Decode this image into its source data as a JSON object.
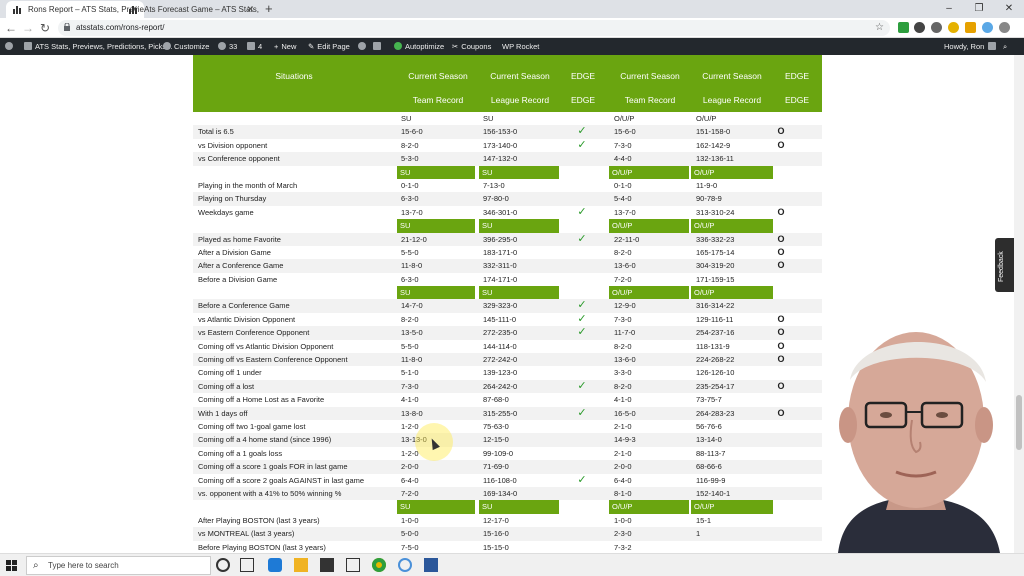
{
  "browser": {
    "tabs": [
      {
        "label": "Rons Report – ATS Stats, Previe",
        "active": true
      },
      {
        "label": "Ats Forecast Game – ATS Stats, F",
        "active": false
      }
    ],
    "url": "atsstats.com/rons-report/"
  },
  "wpbar": {
    "site": "ATS Stats, Previews, Predictions, Picks...",
    "customize": "Customize",
    "updates": "33",
    "comments": "4",
    "new": "New",
    "edit": "Edit Page",
    "autoptimize": "Autoptimize",
    "coupons": "Coupons",
    "wprocket": "WP Rocket",
    "howdy": "Howdy, Ron"
  },
  "table": {
    "headers": {
      "situations": "Situations",
      "current_season": "Current Season",
      "edge": "EDGE",
      "team_record": "Team Record",
      "league_record": "League Record"
    },
    "rows": [
      {
        "type": "data",
        "sit": "",
        "tr": "SU",
        "lr": "SU",
        "e1": "",
        "tr2": "O/U/P",
        "lr2": "O/U/P",
        "e2": ""
      },
      {
        "type": "data",
        "sit": "Total is 6.5",
        "tr": "15-6-0",
        "lr": "156-153-0",
        "e1": "✓",
        "tr2": "15-6-0",
        "lr2": "151-158-0",
        "e2": "O"
      },
      {
        "type": "data",
        "sit": "vs Division opponent",
        "tr": "8-2-0",
        "lr": "173-140-0",
        "e1": "✓",
        "tr2": "7-3-0",
        "lr2": "162-142-9",
        "e2": "O"
      },
      {
        "type": "data",
        "sit": "vs Conference opponent",
        "tr": "5-3-0",
        "lr": "147-132-0",
        "e1": "",
        "tr2": "4-4-0",
        "lr2": "132-136-11",
        "e2": ""
      },
      {
        "type": "sub",
        "su": "SU",
        "ou": "O/U/P"
      },
      {
        "type": "data",
        "sit": "Playing in the month of March",
        "tr": "0-1-0",
        "lr": "7-13-0",
        "e1": "",
        "tr2": "0-1-0",
        "lr2": "11-9-0",
        "e2": ""
      },
      {
        "type": "data",
        "sit": "Playing on Thursday",
        "tr": "6-3-0",
        "lr": "97-80-0",
        "e1": "",
        "tr2": "5-4-0",
        "lr2": "90-78-9",
        "e2": ""
      },
      {
        "type": "data",
        "sit": "Weekdays game",
        "tr": "13-7-0",
        "lr": "346-301-0",
        "e1": "✓",
        "tr2": "13-7-0",
        "lr2": "313-310-24",
        "e2": "O"
      },
      {
        "type": "sub",
        "su": "SU",
        "ou": "O/U/P"
      },
      {
        "type": "data",
        "sit": "Played as home Favorite",
        "tr": "21-12-0",
        "lr": "396-295-0",
        "e1": "✓",
        "tr2": "22-11-0",
        "lr2": "336-332-23",
        "e2": "O"
      },
      {
        "type": "data",
        "sit": "After a Division Game",
        "tr": "5-5-0",
        "lr": "183-171-0",
        "e1": "",
        "tr2": "8-2-0",
        "lr2": "165-175-14",
        "e2": "O"
      },
      {
        "type": "data",
        "sit": "After a Conference Game",
        "tr": "11-8-0",
        "lr": "332-311-0",
        "e1": "",
        "tr2": "13-6-0",
        "lr2": "304-319-20",
        "e2": "O"
      },
      {
        "type": "data",
        "sit": "Before a Division Game",
        "tr": "6-3-0",
        "lr": "174-171-0",
        "e1": "",
        "tr2": "7-2-0",
        "lr2": "171-159-15",
        "e2": ""
      },
      {
        "type": "sub",
        "su": "SU",
        "ou": "O/U/P"
      },
      {
        "type": "data",
        "sit": "Before a Conference Game",
        "tr": "14-7-0",
        "lr": "329-323-0",
        "e1": "✓",
        "tr2": "12-9-0",
        "lr2": "316-314-22",
        "e2": ""
      },
      {
        "type": "data",
        "sit": "vs Atlantic Division Opponent",
        "tr": "8-2-0",
        "lr": "145-111-0",
        "e1": "✓",
        "tr2": "7-3-0",
        "lr2": "129-116-11",
        "e2": "O"
      },
      {
        "type": "data",
        "sit": "vs Eastern Conference Opponent",
        "tr": "13-5-0",
        "lr": "272-235-0",
        "e1": "✓",
        "tr2": "11-7-0",
        "lr2": "254-237-16",
        "e2": "O"
      },
      {
        "type": "data",
        "sit": "Coming off vs Atlantic Division Opponent",
        "tr": "5-5-0",
        "lr": "144-114-0",
        "e1": "",
        "tr2": "8-2-0",
        "lr2": "118-131-9",
        "e2": "O"
      },
      {
        "type": "data",
        "sit": "Coming off vs Eastern Conference Opponent",
        "tr": "11-8-0",
        "lr": "272-242-0",
        "e1": "",
        "tr2": "13-6-0",
        "lr2": "224-268-22",
        "e2": "O"
      },
      {
        "type": "data",
        "sit": "Coming off 1 under",
        "tr": "5-1-0",
        "lr": "139-123-0",
        "e1": "",
        "tr2": "3-3-0",
        "lr2": "126-126-10",
        "e2": ""
      },
      {
        "type": "data",
        "sit": "Coming off a lost",
        "tr": "7-3-0",
        "lr": "264-242-0",
        "e1": "✓",
        "tr2": "8-2-0",
        "lr2": "235-254-17",
        "e2": "O"
      },
      {
        "type": "data",
        "sit": "Coming off a Home Lost as a Favorite",
        "tr": "4-1-0",
        "lr": "87-68-0",
        "e1": "",
        "tr2": "4-1-0",
        "lr2": "73-75-7",
        "e2": ""
      },
      {
        "type": "data",
        "sit": "With 1 days off",
        "tr": "13-8-0",
        "lr": "315-255-0",
        "e1": "✓",
        "tr2": "16-5-0",
        "lr2": "264-283-23",
        "e2": "O"
      },
      {
        "type": "data",
        "sit": "Coming off two 1-goal game lost",
        "tr": "1-2-0",
        "lr": "75-63-0",
        "e1": "",
        "tr2": "2-1-0",
        "lr2": "56-76-6",
        "e2": ""
      },
      {
        "type": "data",
        "sit": "Coming off a 4 home stand (since 1996)",
        "tr": "13-13-0",
        "lr": "12-15-0",
        "e1": "",
        "tr2": "14-9-3",
        "lr2": "13-14-0",
        "e2": ""
      },
      {
        "type": "data",
        "sit": "Coming off a 1 goals loss",
        "tr": "1-2-0",
        "lr": "99-109-0",
        "e1": "",
        "tr2": "2-1-0",
        "lr2": "88-113-7",
        "e2": ""
      },
      {
        "type": "data",
        "sit": "Coming off a score 1 goals FOR in last game",
        "tr": "2-0-0",
        "lr": "71-69-0",
        "e1": "",
        "tr2": "2-0-0",
        "lr2": "68-66-6",
        "e2": ""
      },
      {
        "type": "data",
        "sit": "Coming off a score 2 goals AGAINST in last game",
        "tr": "6-4-0",
        "lr": "116-108-0",
        "e1": "✓",
        "tr2": "6-4-0",
        "lr2": "116-99-9",
        "e2": ""
      },
      {
        "type": "data",
        "sit": "vs. opponent with a 41% to 50% winning %",
        "tr": "7-2-0",
        "lr": "169-134-0",
        "e1": "",
        "tr2": "8-1-0",
        "lr2": "152-140-1",
        "e2": ""
      },
      {
        "type": "sub",
        "su": "SU",
        "ou": "O/U/P"
      },
      {
        "type": "data",
        "sit": "After Playing BOSTON (last 3 years)",
        "tr": "1-0-0",
        "lr": "12-17-0",
        "e1": "",
        "tr2": "1-0-0",
        "lr2": "15-1",
        "e2": ""
      },
      {
        "type": "data",
        "sit": "vs MONTREAL (last 3 years)",
        "tr": "5-0-0",
        "lr": "15-16-0",
        "e1": "",
        "tr2": "2-3-0",
        "lr2": "1",
        "e2": ""
      },
      {
        "type": "data",
        "sit": "Before Playing BOSTON (last 3 years)",
        "tr": "7-5-0",
        "lr": "15-15-0",
        "e1": "",
        "tr2": "7-3-2",
        "lr2": "",
        "e2": ""
      }
    ]
  },
  "feedback": "Feedback",
  "taskbar": {
    "search_placeholder": "Type here to search"
  }
}
